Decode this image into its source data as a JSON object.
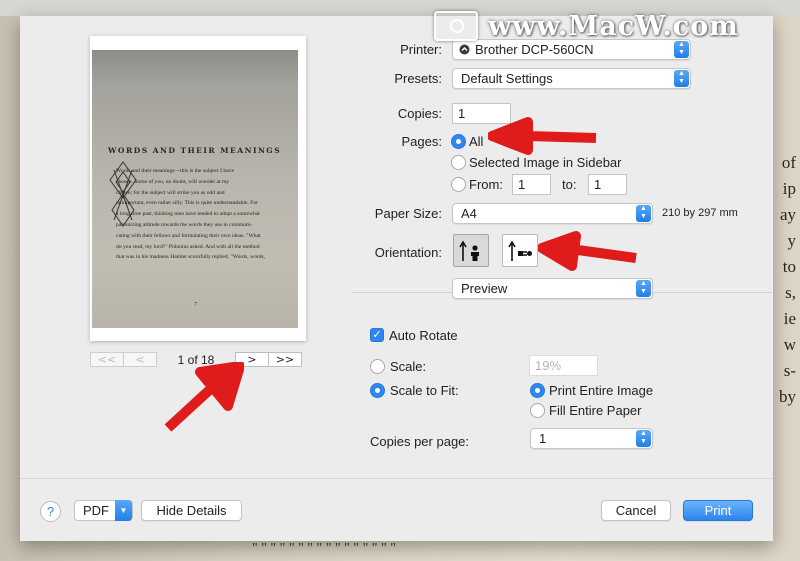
{
  "watermark": "www.MacW.com",
  "background": {
    "side_words": [
      "of",
      "ip",
      "ay",
      "y",
      "to",
      "s,",
      "ie",
      "w",
      "s-",
      "by"
    ],
    "bottom_text": "\" \" \" \" \" \" \" \" \" \" \" \" \" \" \" \""
  },
  "preview": {
    "book_title": "WORDS AND THEIR MEANINGS",
    "book_lines": [
      "Words and their meanings—this is the subject I have",
      "chosen. Some of you, no doubt, will wonder at my",
      "choice; for the subject will strike you as odd and",
      "unimportant, even rather silly. This is quite understandable. For",
      "a long time past, thinking men have tended to adopt a somewhat",
      "patronizing attitude towards the words they use in communi-",
      "cating with their fellows and formulating their own ideas. \"What",
      "do you read, my lord?\" Polonius asked. And with all the method",
      "that was in his madness Hamlet scornfully replied, \"Words, words,"
    ],
    "page_number": "7",
    "pager": {
      "first": "<<",
      "prev": "<",
      "label": "1 of 18",
      "next": ">",
      "last": ">>"
    }
  },
  "settings": {
    "printer": {
      "label": "Printer:",
      "value": "Brother DCP-560CN"
    },
    "presets": {
      "label": "Presets:",
      "value": "Default Settings"
    },
    "copies": {
      "label": "Copies:",
      "value": "1"
    },
    "pages": {
      "label": "Pages:",
      "all": "All",
      "selected_image": "Selected Image in Sidebar",
      "from_label": "From:",
      "from_value": "1",
      "to_label": "to:",
      "to_value": "1",
      "selected": "All"
    },
    "paper_size": {
      "label": "Paper Size:",
      "value": "A4",
      "dimensions": "210 by 297 mm"
    },
    "orientation": {
      "label": "Orientation:",
      "selected": "portrait"
    },
    "section_popup": "Preview",
    "auto_rotate": {
      "label": "Auto Rotate",
      "checked": true
    },
    "scale": {
      "label": "Scale:",
      "value": "19%"
    },
    "scale_to_fit": {
      "label": "Scale to Fit:",
      "print_entire_image": "Print Entire Image",
      "fill_entire_paper": "Fill Entire Paper",
      "selected": "Print Entire Image"
    },
    "copies_per_page": {
      "label": "Copies per page:",
      "value": "1"
    }
  },
  "footer": {
    "help": "?",
    "pdf": "PDF",
    "hide_details": "Hide Details",
    "cancel": "Cancel",
    "print": "Print"
  },
  "colors": {
    "accent": "#2e86f0",
    "arrow": "#e01b1b",
    "sheet": "#ececec"
  },
  "icons": [
    "stepper-icon",
    "printer-status-icon",
    "portrait-icon",
    "landscape-icon",
    "checkmark-icon",
    "help-icon",
    "red-arrow-annotation"
  ]
}
